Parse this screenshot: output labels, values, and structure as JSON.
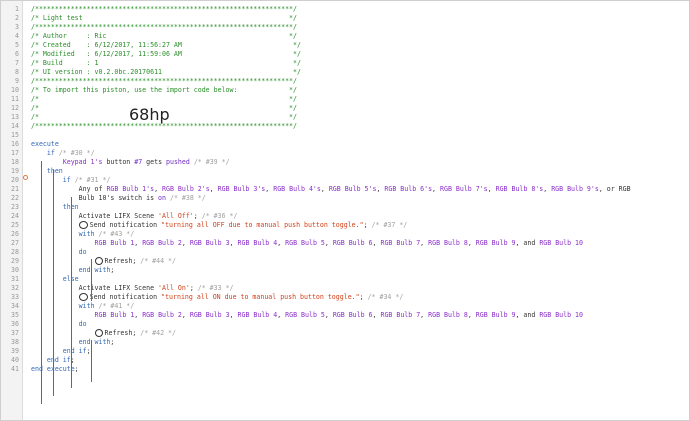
{
  "lines": [
    {
      "n": "1",
      "t": "/*****************************************************************/"
    },
    {
      "n": "2",
      "t": "/* Light test                                                    */"
    },
    {
      "n": "3",
      "t": "/*****************************************************************/"
    },
    {
      "n": "4",
      "t": "/* Author     : Ric                                              */"
    },
    {
      "n": "5",
      "t": "/* Created    : 6/12/2017, 11:56:27 AM                            */"
    },
    {
      "n": "6",
      "t": "/* Modified   : 6/12/2017, 11:59:06 AM                            */"
    },
    {
      "n": "7",
      "t": "/* Build      : 1                                                 */"
    },
    {
      "n": "8",
      "t": "/* UI version : v0.2.0bc.20170611                                 */"
    },
    {
      "n": "9",
      "t": "/*****************************************************************/"
    },
    {
      "n": "10",
      "t": "/* To import this piston, use the import code below:             */"
    },
    {
      "n": "11",
      "t": "/*                                                               */"
    },
    {
      "n": "12",
      "t": "/*                                                               */"
    },
    {
      "n": "13",
      "t": "/*                                                               */"
    },
    {
      "n": "14",
      "t": "/*****************************************************************/"
    },
    {
      "n": "15",
      "t": ""
    },
    {
      "n": "16",
      "t": "execute"
    },
    {
      "n": "17",
      "t": "    if /* #30 */"
    },
    {
      "n": "18",
      "t": "        Keypad 1's button #7 gets pushed /* #39 */"
    },
    {
      "n": "19",
      "t": "    then"
    },
    {
      "n": "20",
      "t": "        if /* #31 */"
    },
    {
      "n": "21",
      "t": "            Any of RGB Bulb 1's, RGB Bulb 2's, RGB Bulb 3's, RGB Bulb 4's, RGB Bulb 5's, RGB Bulb 6's, RGB Bulb 7's, RGB Bulb 8's, RGB Bulb 9's, or RGB"
    },
    {
      "n": "22",
      "t": "            Bulb 10's switch is on /* #38 */"
    },
    {
      "n": "23",
      "t": "        then"
    },
    {
      "n": "24",
      "t": "            Activate LIFX Scene 'All Off'; /* #36 */"
    },
    {
      "n": "25",
      "t": "            Send notification \"turning all OFF due to manual push button toggle.\"; /* #37 */"
    },
    {
      "n": "26",
      "t": "            with /* #43 */"
    },
    {
      "n": "27",
      "t": "                RGB Bulb 1, RGB Bulb 2, RGB Bulb 3, RGB Bulb 4, RGB Bulb 5, RGB Bulb 6, RGB Bulb 7, RGB Bulb 8, RGB Bulb 9, and RGB Bulb 10"
    },
    {
      "n": "28",
      "t": "            do"
    },
    {
      "n": "29",
      "t": "                Refresh; /* #44 */"
    },
    {
      "n": "30",
      "t": "            end with;"
    },
    {
      "n": "31",
      "t": "        else"
    },
    {
      "n": "32",
      "t": "            Activate LIFX Scene 'All On'; /* #33 */"
    },
    {
      "n": "33",
      "t": "            Send notification \"turning all ON due to manual push button toggle.\"; /* #34 */"
    },
    {
      "n": "34",
      "t": "            with /* #41 */"
    },
    {
      "n": "35",
      "t": "                RGB Bulb 1, RGB Bulb 2, RGB Bulb 3, RGB Bulb 4, RGB Bulb 5, RGB Bulb 6, RGB Bulb 7, RGB Bulb 8, RGB Bulb 9, and RGB Bulb 10"
    },
    {
      "n": "36",
      "t": "            do"
    },
    {
      "n": "37",
      "t": "                Refresh; /* #42 */"
    },
    {
      "n": "38",
      "t": "            end with;"
    },
    {
      "n": "39",
      "t": "        end if;"
    },
    {
      "n": "40",
      "t": "    end if;"
    },
    {
      "n": "41",
      "t": "end execute;"
    }
  ],
  "import_code": "68hp",
  "colors": {
    "comment": "#2a8f2a",
    "keyword": "#3468b6",
    "device": "#8a2fc9",
    "string": "#d0421b",
    "guide": "#2f76b9"
  },
  "icons": {
    "notification": "chat-bubble-icon",
    "refresh": "refresh-icon",
    "marker": "circle-marker-icon"
  }
}
